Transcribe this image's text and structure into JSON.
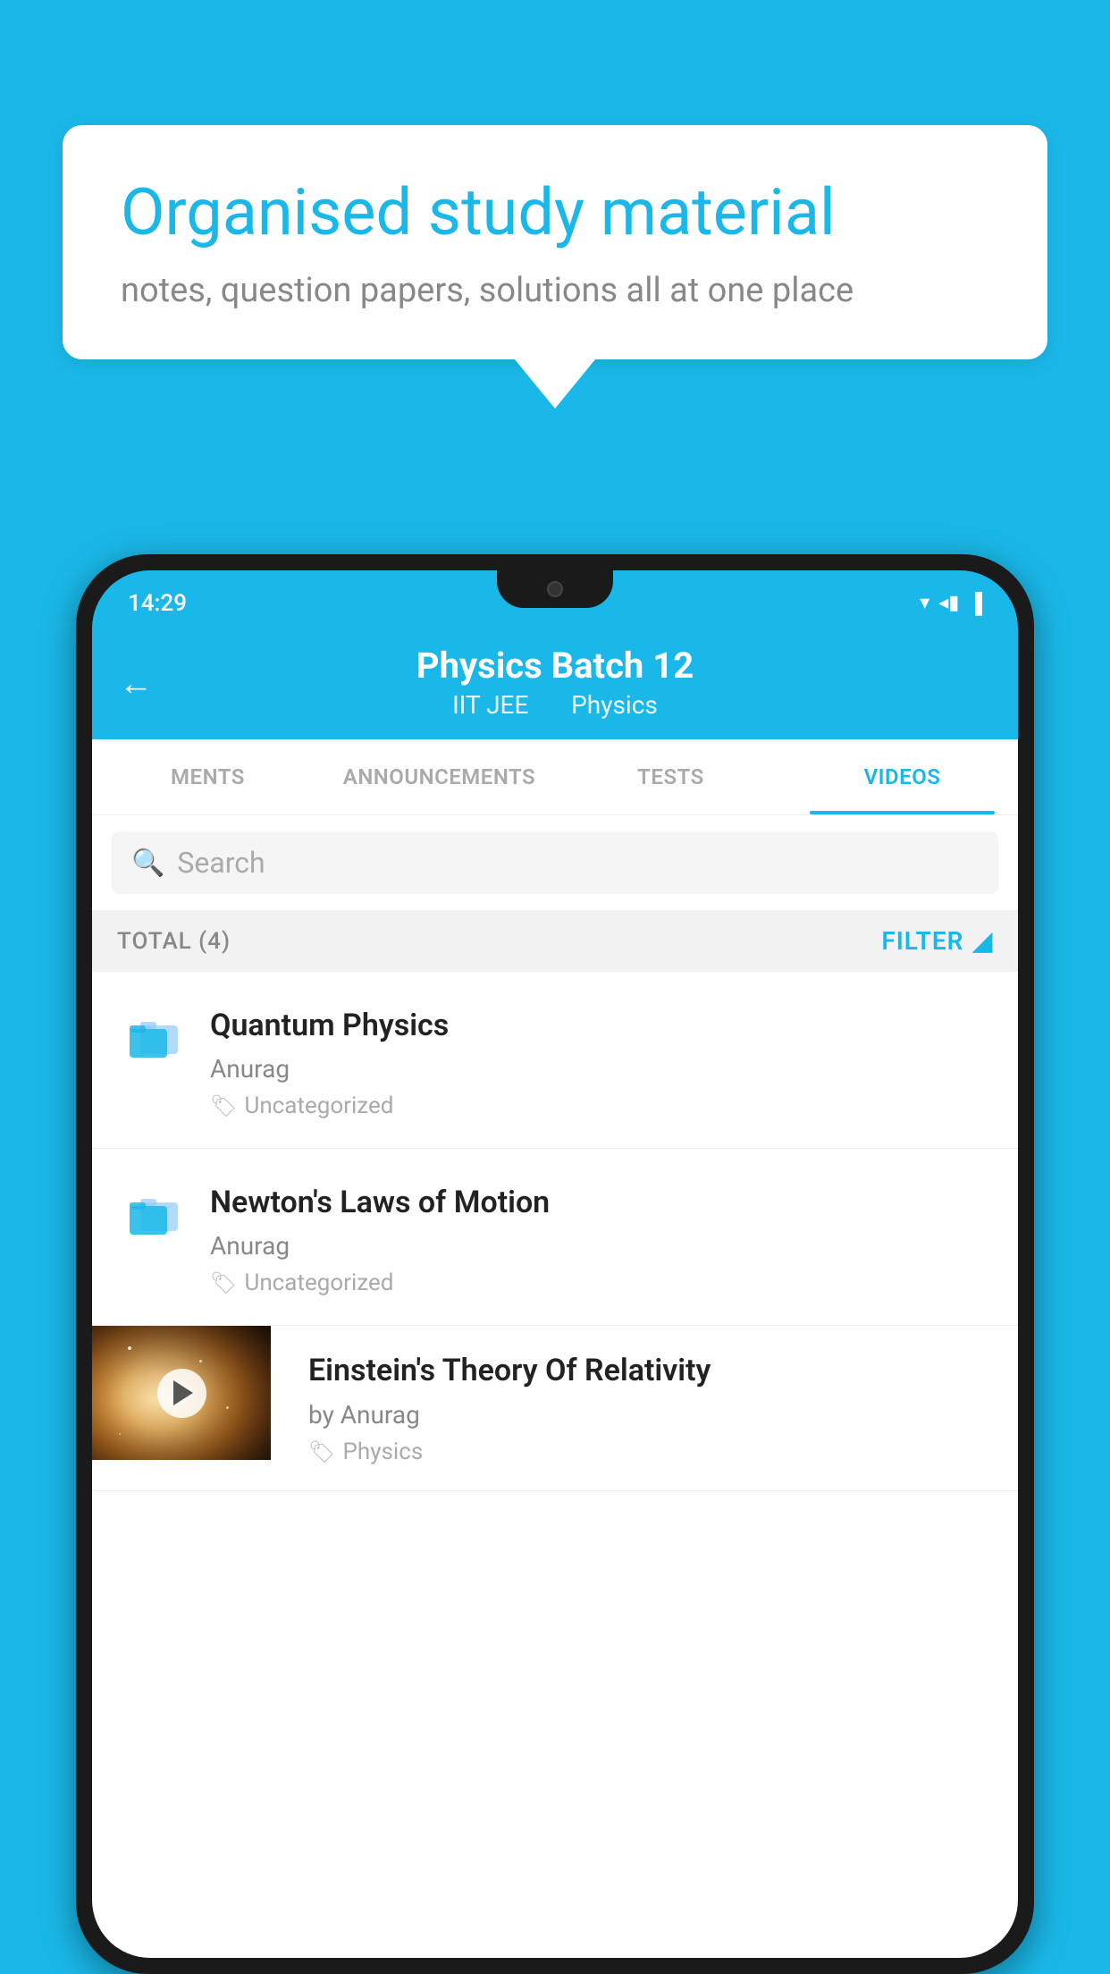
{
  "background_color": "#1ab8e8",
  "speech_bubble": {
    "title": "Organised study material",
    "subtitle": "notes, question papers, solutions all at one place"
  },
  "phone": {
    "status_bar": {
      "time": "14:29",
      "icons": "▼◀▐"
    },
    "header": {
      "back_label": "←",
      "title": "Physics Batch 12",
      "subtitle_part1": "IIT JEE",
      "subtitle_part2": "Physics"
    },
    "tabs": [
      {
        "label": "MENTS",
        "active": false
      },
      {
        "label": "ANNOUNCEMENTS",
        "active": false
      },
      {
        "label": "TESTS",
        "active": false
      },
      {
        "label": "VIDEOS",
        "active": true
      }
    ],
    "search": {
      "placeholder": "Search"
    },
    "filter_bar": {
      "total_label": "TOTAL (4)",
      "filter_label": "FILTER"
    },
    "video_items": [
      {
        "id": 1,
        "title": "Quantum Physics",
        "author": "Anurag",
        "tag": "Uncategorized",
        "type": "folder",
        "has_thumbnail": false
      },
      {
        "id": 2,
        "title": "Newton's Laws of Motion",
        "author": "Anurag",
        "tag": "Uncategorized",
        "type": "folder",
        "has_thumbnail": false
      },
      {
        "id": 3,
        "title": "Einstein's Theory Of Relativity",
        "author": "by Anurag",
        "tag": "Physics",
        "type": "video",
        "has_thumbnail": true
      }
    ]
  }
}
